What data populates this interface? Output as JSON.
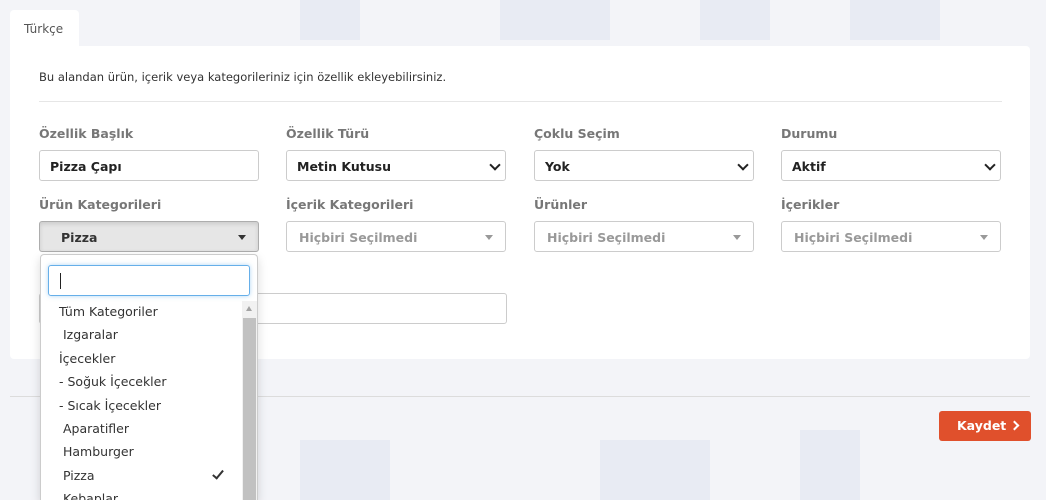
{
  "tab": {
    "label": "Türkçe"
  },
  "form": {
    "description": "Bu alandan ürün, içerik veya kategorileriniz için özellik ekleyebilirsiniz.",
    "feature_title": {
      "label": "Özellik Başlık",
      "value": "Pizza Çapı"
    },
    "feature_type": {
      "label": "Özellik Türü",
      "value": "Metin Kutusu"
    },
    "multi_select": {
      "label": "Çoklu Seçim",
      "value": "Yok"
    },
    "status": {
      "label": "Durumu",
      "value": "Aktif"
    },
    "product_categories": {
      "label": "Ürün Kategorileri",
      "value": "Pizza"
    },
    "content_categories": {
      "label": "İçerik Kategorileri",
      "value": "Hiçbiri Seçilmedi"
    },
    "products": {
      "label": "Ürünler",
      "value": "Hiçbiri Seçilmedi"
    },
    "contents": {
      "label": "İçerikler",
      "value": "Hiçbiri Seçilmedi"
    }
  },
  "dropdown": {
    "search_value": "",
    "items": [
      {
        "label": "Tüm Kategoriler",
        "selected": false
      },
      {
        "label": " Izgaralar",
        "selected": false
      },
      {
        "label": "İçecekler",
        "selected": false
      },
      {
        "label": "- Soğuk İçecekler",
        "selected": false
      },
      {
        "label": "- Sıcak İçecekler",
        "selected": false
      },
      {
        "label": " Aparatifler",
        "selected": false
      },
      {
        "label": " Hamburger",
        "selected": false
      },
      {
        "label": " Pizza",
        "selected": true
      },
      {
        "label": " Kebaplar",
        "selected": false
      }
    ]
  },
  "save_button": {
    "label": "Kaydet",
    "icon": "chevron-right-icon",
    "color": "#e0502c"
  }
}
